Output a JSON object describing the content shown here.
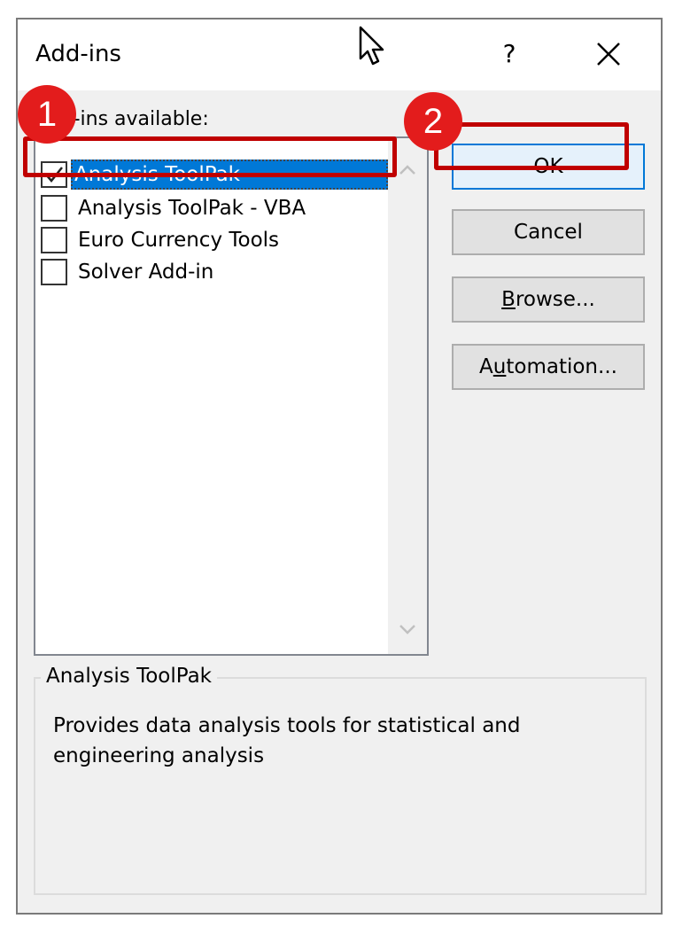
{
  "dialog": {
    "title": "Add-ins",
    "help_label": "?",
    "close_icon": "close-icon"
  },
  "list": {
    "label": "Add-ins available:",
    "items": [
      {
        "label": "Analysis ToolPak",
        "checked": true,
        "selected": true
      },
      {
        "label": "Analysis ToolPak - VBA",
        "checked": false,
        "selected": false
      },
      {
        "label": "Euro Currency Tools",
        "checked": false,
        "selected": false
      },
      {
        "label": "Solver Add-in",
        "checked": false,
        "selected": false
      }
    ]
  },
  "buttons": {
    "ok": "OK",
    "cancel": "Cancel",
    "browse_prefix": "B",
    "browse_rest": "rowse...",
    "automation_prefix": "A",
    "automation_underline": "u",
    "automation_rest": "tomation..."
  },
  "details": {
    "title": "Analysis ToolPak",
    "description": "Provides data analysis tools for statistical and engineering analysis"
  },
  "annotations": {
    "step1": "1",
    "step2": "2",
    "highlight_color": "#c00000",
    "badge_color": "#e31c1c"
  },
  "colors": {
    "selection": "#0078d7",
    "dialog_bg": "#f0f0f0"
  }
}
